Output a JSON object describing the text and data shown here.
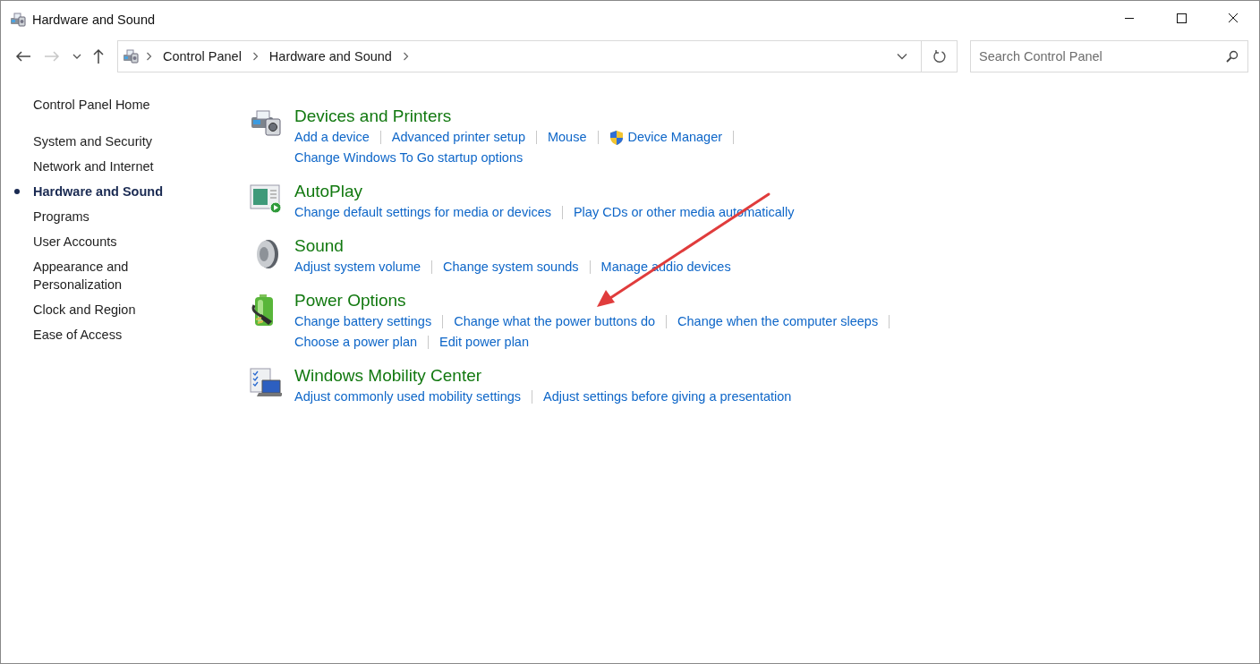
{
  "window": {
    "title": "Hardware and Sound"
  },
  "address_bar": {
    "breadcrumbs": [
      "Control Panel",
      "Hardware and Sound"
    ]
  },
  "search": {
    "placeholder": "Search Control Panel"
  },
  "sidebar": {
    "home": "Control Panel Home",
    "items": [
      {
        "label": "System and Security",
        "selected": false
      },
      {
        "label": "Network and Internet",
        "selected": false
      },
      {
        "label": "Hardware and Sound",
        "selected": true
      },
      {
        "label": "Programs",
        "selected": false
      },
      {
        "label": "User Accounts",
        "selected": false
      },
      {
        "label": "Appearance and Personalization",
        "selected": false
      },
      {
        "label": "Clock and Region",
        "selected": false
      },
      {
        "label": "Ease of Access",
        "selected": false
      }
    ]
  },
  "sections": [
    {
      "kind": "devices",
      "title": "Devices and Printers",
      "lines": [
        [
          {
            "label": "Add a device",
            "kind": "plain"
          },
          {
            "label": "Advanced printer setup",
            "kind": "plain"
          },
          {
            "label": "Mouse",
            "kind": "plain"
          },
          {
            "label": "Device Manager",
            "kind": "shield"
          }
        ],
        [
          {
            "label": "Change Windows To Go startup options",
            "kind": "plain"
          }
        ]
      ]
    },
    {
      "kind": "autoplay",
      "title": "AutoPlay",
      "lines": [
        [
          {
            "label": "Change default settings for media or devices",
            "kind": "plain"
          },
          {
            "label": "Play CDs or other media automatically",
            "kind": "plain"
          }
        ]
      ]
    },
    {
      "kind": "sound",
      "title": "Sound",
      "lines": [
        [
          {
            "label": "Adjust system volume",
            "kind": "plain"
          },
          {
            "label": "Change system sounds",
            "kind": "plain"
          },
          {
            "label": "Manage audio devices",
            "kind": "plain"
          }
        ]
      ]
    },
    {
      "kind": "power",
      "title": "Power Options",
      "lines": [
        [
          {
            "label": "Change battery settings",
            "kind": "plain"
          },
          {
            "label": "Change what the power buttons do",
            "kind": "plain"
          },
          {
            "label": "Change when the computer sleeps",
            "kind": "plain"
          }
        ],
        [
          {
            "label": "Choose a power plan",
            "kind": "plain"
          },
          {
            "label": "Edit power plan",
            "kind": "plain"
          }
        ]
      ]
    },
    {
      "kind": "mobility",
      "title": "Windows Mobility Center",
      "lines": [
        [
          {
            "label": "Adjust commonly used mobility settings",
            "kind": "plain"
          },
          {
            "label": "Adjust settings before giving a presentation",
            "kind": "plain"
          }
        ]
      ]
    }
  ]
}
